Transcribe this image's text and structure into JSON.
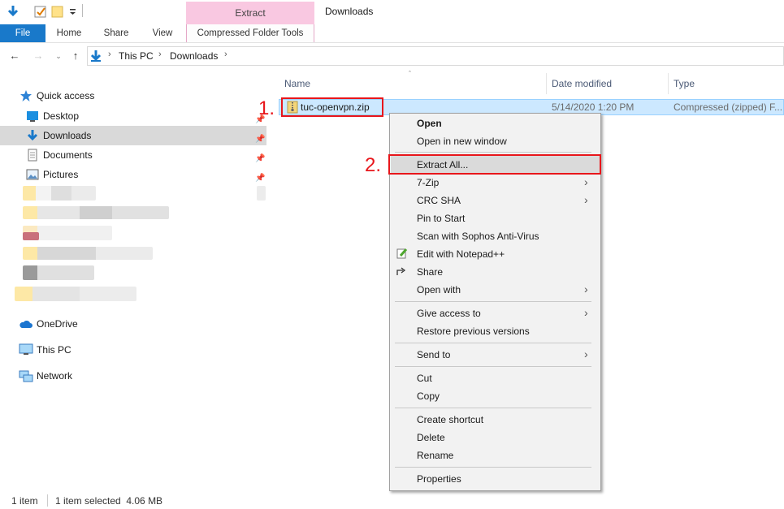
{
  "window": {
    "title": "Downloads"
  },
  "ribbon": {
    "contextual_header": "Extract",
    "tabs": [
      "File",
      "Home",
      "Share",
      "View",
      "Compressed Folder Tools"
    ]
  },
  "address": {
    "crumbs": [
      "This PC",
      "Downloads"
    ]
  },
  "nav": {
    "quick_access": "Quick access",
    "items": [
      "Desktop",
      "Downloads",
      "Documents",
      "Pictures"
    ],
    "onedrive": "OneDrive",
    "this_pc": "This PC",
    "network": "Network"
  },
  "columns": {
    "name": "Name",
    "date": "Date modified",
    "type": "Type"
  },
  "file": {
    "name": "tuc-openvpn.zip",
    "date": "5/14/2020 1:20 PM",
    "type": "Compressed (zipped) F..."
  },
  "annotations": {
    "step1": "1.",
    "step2": "2."
  },
  "context_menu": {
    "open": "Open",
    "open_new_window": "Open in new window",
    "extract_all": "Extract All...",
    "seven_zip": "7-Zip",
    "crc_sha": "CRC SHA",
    "pin_to_start": "Pin to Start",
    "scan": "Scan with Sophos Anti-Virus",
    "edit_notepad": "Edit with Notepad++",
    "share": "Share",
    "open_with": "Open with",
    "give_access": "Give access to",
    "restore": "Restore previous versions",
    "send_to": "Send to",
    "cut": "Cut",
    "copy": "Copy",
    "create_shortcut": "Create shortcut",
    "delete": "Delete",
    "rename": "Rename",
    "properties": "Properties"
  },
  "status": {
    "count": "1 item",
    "selected": "1 item selected  4.06 MB"
  },
  "colors": {
    "accent": "#1979ca",
    "selection": "#cce8ff",
    "annotation": "#e8161b"
  }
}
